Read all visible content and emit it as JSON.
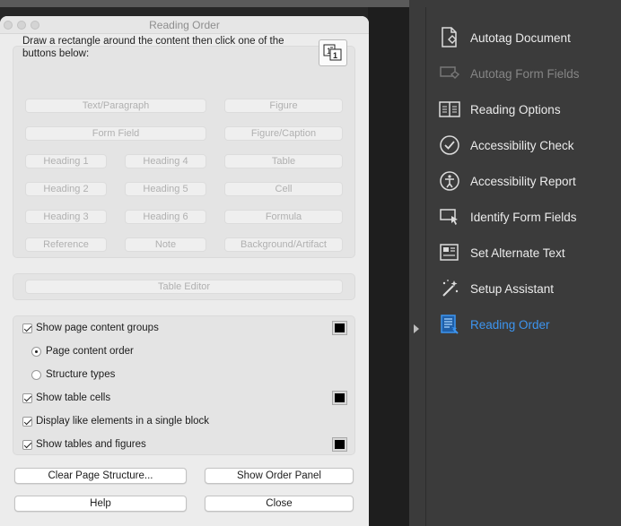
{
  "dialog": {
    "title": "Reading Order",
    "instructions": "Draw a rectangle around the content then click one of the buttons below:",
    "tag_buttons": {
      "text_paragraph": "Text/Paragraph",
      "figure": "Figure",
      "form_field": "Form Field",
      "figure_caption": "Figure/Caption",
      "heading1": "Heading 1",
      "heading4": "Heading 4",
      "table": "Table",
      "heading2": "Heading 2",
      "heading5": "Heading 5",
      "cell": "Cell",
      "heading3": "Heading 3",
      "heading6": "Heading 6",
      "formula": "Formula",
      "reference": "Reference",
      "note": "Note",
      "background_artifact": "Background/Artifact"
    },
    "table_editor": "Table Editor",
    "options": {
      "show_page_content_groups": "Show page content groups",
      "page_content_order": "Page content order",
      "structure_types": "Structure types",
      "show_table_cells": "Show table cells",
      "display_like_elements": "Display like elements in a single block",
      "show_tables_and_figures": "Show tables and figures"
    },
    "buttons": {
      "clear_page_structure": "Clear Page Structure...",
      "show_order_panel": "Show Order Panel",
      "help": "Help",
      "close": "Close"
    },
    "swatch_color": "#000000"
  },
  "tools": {
    "items": [
      {
        "label": "Autotag Document",
        "icon": "autotag-document-icon"
      },
      {
        "label": "Autotag Form Fields",
        "icon": "autotag-form-fields-icon"
      },
      {
        "label": "Reading Options",
        "icon": "reading-options-icon"
      },
      {
        "label": "Accessibility Check",
        "icon": "accessibility-check-icon"
      },
      {
        "label": "Accessibility Report",
        "icon": "accessibility-report-icon"
      },
      {
        "label": "Identify Form Fields",
        "icon": "identify-form-fields-icon"
      },
      {
        "label": "Set Alternate Text",
        "icon": "set-alternate-text-icon"
      },
      {
        "label": "Setup Assistant",
        "icon": "setup-assistant-icon"
      },
      {
        "label": "Reading Order",
        "icon": "reading-order-icon"
      }
    ],
    "active_color": "#3d95f0"
  }
}
